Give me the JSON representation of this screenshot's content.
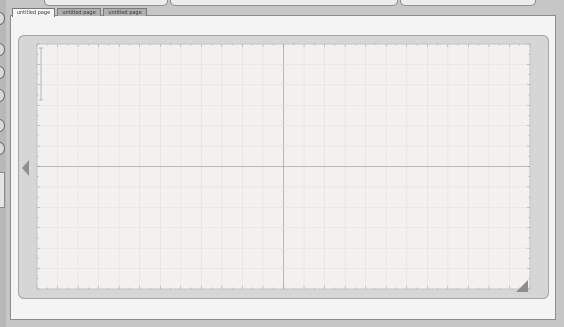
{
  "tabs": [
    {
      "label": "untitled page",
      "active": true
    },
    {
      "label": "untitled page",
      "active": false
    },
    {
      "label": "untitled page",
      "active": false
    }
  ],
  "colors": {
    "background": "#c6c6c6",
    "mat": "#d6d6d6",
    "grid_surface": "#f2f1ef",
    "grid_line": "#e2e2e2",
    "center_line": "#a8a8a8",
    "ruler_text": "#9a9a9a"
  },
  "icons": [
    "left-arrow-icon",
    "resize-corner-icon"
  ]
}
